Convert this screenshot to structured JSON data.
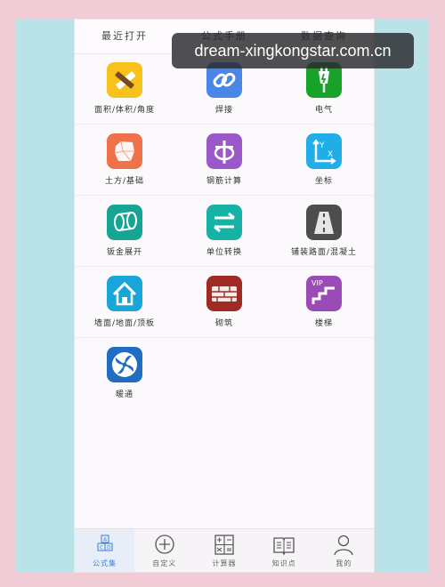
{
  "tabs": [
    "最近打开",
    "公式手册",
    "数据查询"
  ],
  "watermark": "dream-xingkongstar.com.cn",
  "grid": [
    [
      {
        "label": "面积/体积/角度",
        "icon": "ruler-pencil-icon",
        "color": "#f7c21c"
      },
      {
        "label": "焊接",
        "icon": "chain-link-icon",
        "color": "#4a86e8"
      },
      {
        "label": "电气",
        "icon": "plug-icon",
        "color": "#17a32a"
      }
    ],
    [
      {
        "label": "土方/基础",
        "icon": "earth-block-icon",
        "color": "#f0724a"
      },
      {
        "label": "钢筋计算",
        "icon": "rebar-icon",
        "color": "#9a58c8"
      },
      {
        "label": "坐标",
        "icon": "xy-axis-icon",
        "color": "#1faee8"
      }
    ],
    [
      {
        "label": "钣金展开",
        "icon": "cylinder-icon",
        "color": "#16a595"
      },
      {
        "label": "单位转换",
        "icon": "swap-arrows-icon",
        "color": "#17b2a6"
      },
      {
        "label": "铺装路面/混凝土",
        "icon": "road-icon",
        "color": "#4d4d4d"
      }
    ],
    [
      {
        "label": "墙面/地面/顶板",
        "icon": "house-icon",
        "color": "#18a6d8"
      },
      {
        "label": "砌筑",
        "icon": "bricks-icon",
        "color": "#a02a24"
      },
      {
        "label": "楼梯",
        "icon": "stairs-icon",
        "color": "#9a4cb6",
        "badge": "VIP"
      }
    ],
    [
      {
        "label": "暖通",
        "icon": "fan-icon",
        "color": "#1f6ec2"
      }
    ]
  ],
  "bottom_nav": [
    {
      "label": "公式集",
      "icon": "formula-blocks-icon",
      "letters": "A B C D",
      "active": true
    },
    {
      "label": "自定义",
      "icon": "plus-circle-icon",
      "active": false
    },
    {
      "label": "计算器",
      "icon": "calculator-icon",
      "active": false
    },
    {
      "label": "知识点",
      "icon": "book-icon",
      "active": false
    },
    {
      "label": "我的",
      "icon": "user-icon",
      "active": false
    }
  ]
}
